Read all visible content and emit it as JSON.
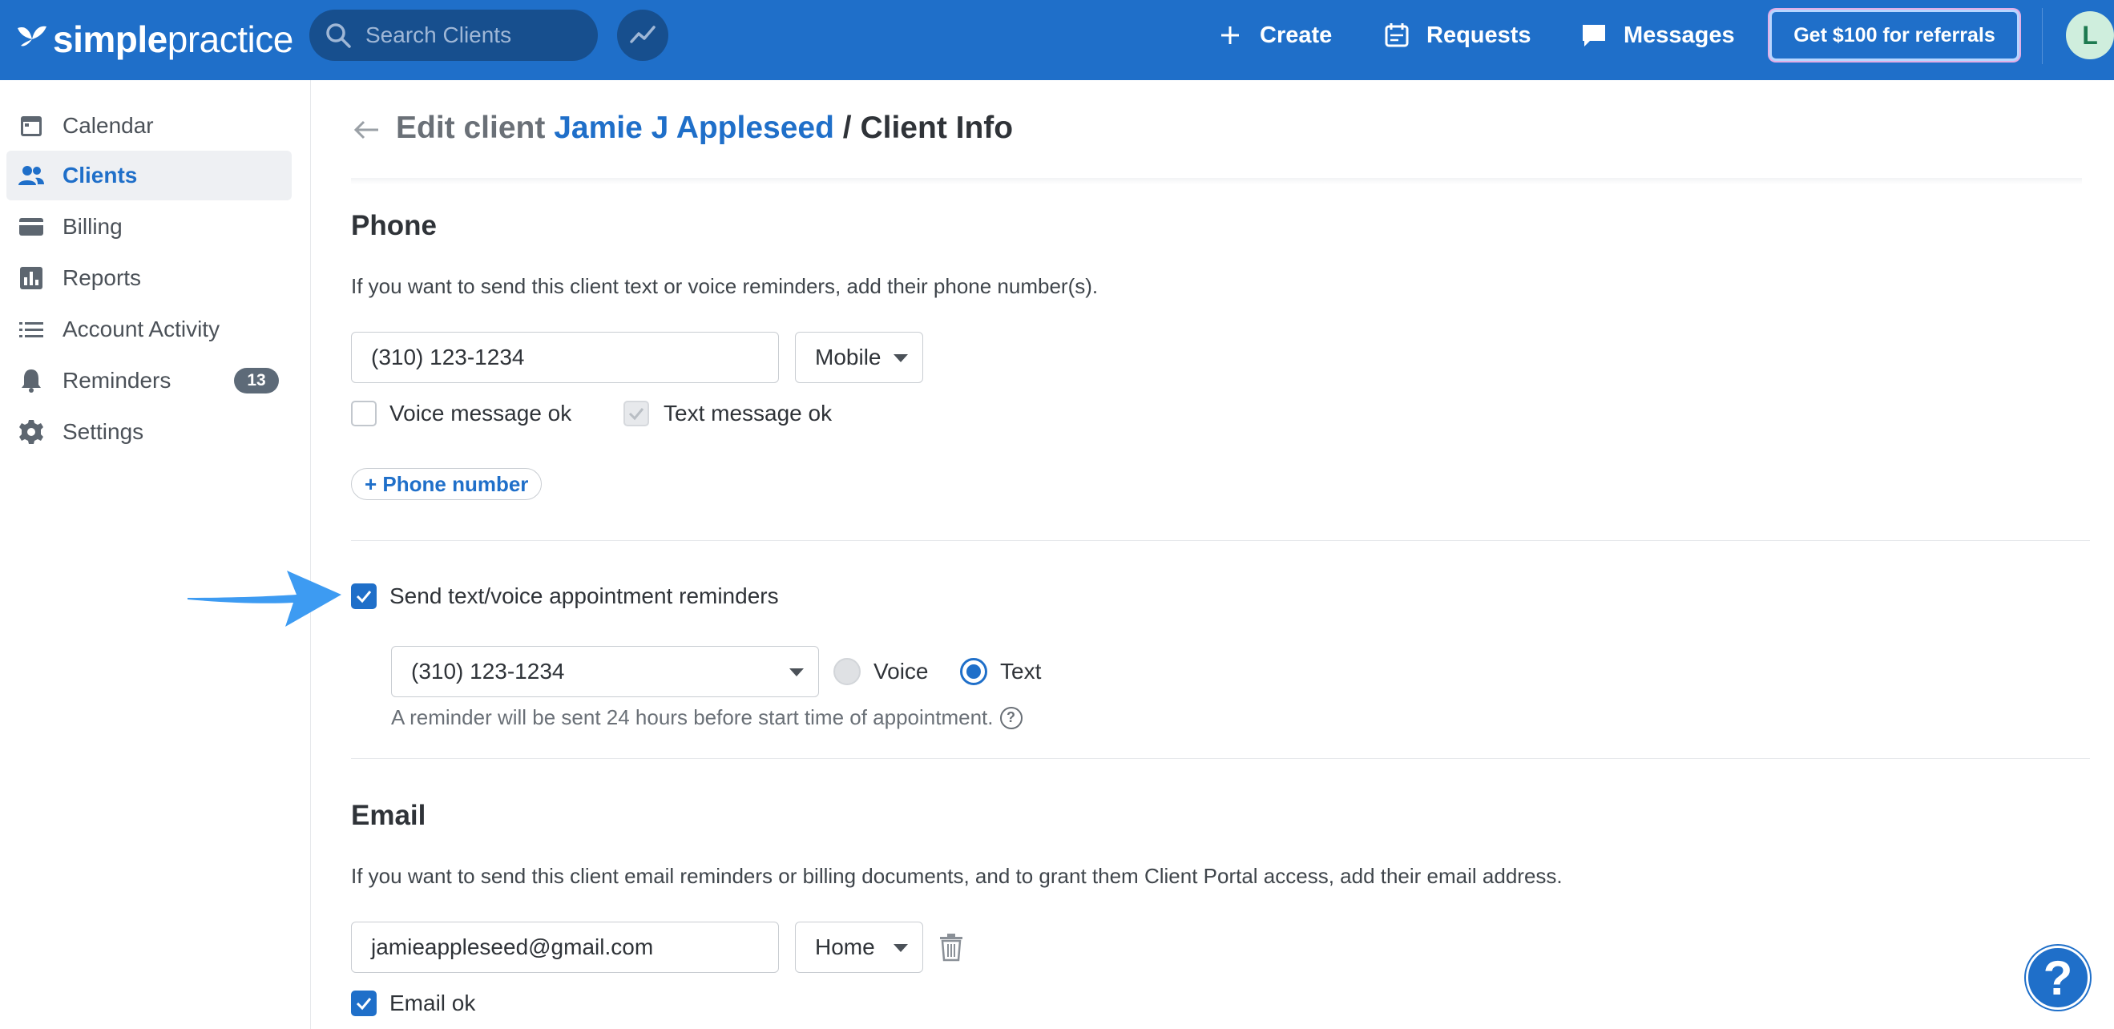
{
  "app": {
    "logo_simple": "simple",
    "logo_practice": "practice",
    "search_placeholder": "Search Clients",
    "nav": {
      "create": "Create",
      "requests": "Requests",
      "messages": "Messages"
    },
    "referral_button": "Get $100 for referrals",
    "avatar_initial": "L",
    "brand_color": "#1f6fc9"
  },
  "sidebar": {
    "items": [
      {
        "label": "Calendar",
        "icon": "calendar-icon",
        "active": false
      },
      {
        "label": "Clients",
        "icon": "clients-icon",
        "active": true
      },
      {
        "label": "Billing",
        "icon": "billing-icon",
        "active": false
      },
      {
        "label": "Reports",
        "icon": "reports-icon",
        "active": false
      },
      {
        "label": "Account Activity",
        "icon": "list-icon",
        "active": false
      },
      {
        "label": "Reminders",
        "icon": "bell-icon",
        "active": false,
        "badge": "13"
      },
      {
        "label": "Settings",
        "icon": "gear-icon",
        "active": false
      }
    ]
  },
  "header": {
    "prefix": "Edit client",
    "client_name": "Jamie J Appleseed",
    "separator": "/",
    "page": "Client Info"
  },
  "phone": {
    "title": "Phone",
    "description": "If you want to send this client text or voice reminders, add their phone number(s).",
    "number": "(310) 123-1234",
    "type": "Mobile",
    "voice_ok_label": "Voice message ok",
    "voice_ok_checked": false,
    "text_ok_label": "Text message ok",
    "text_ok_checked": true,
    "add_button": "+ Phone number"
  },
  "reminders": {
    "checkbox_label": "Send text/voice appointment reminders",
    "checked": true,
    "selected_number": "(310) 123-1234",
    "voice_label": "Voice",
    "text_label": "Text",
    "selected_method": "Text",
    "hint": "A reminder will be sent 24 hours before start time of appointment.",
    "hint_icon": "?"
  },
  "email": {
    "title": "Email",
    "description": "If you want to send this client email reminders or billing documents, and to grant them Client Portal access, add their email address.",
    "address": "jamieappleseed@gmail.com",
    "type": "Home",
    "email_ok_label": "Email ok",
    "email_ok_checked": true
  },
  "help_button": "?"
}
